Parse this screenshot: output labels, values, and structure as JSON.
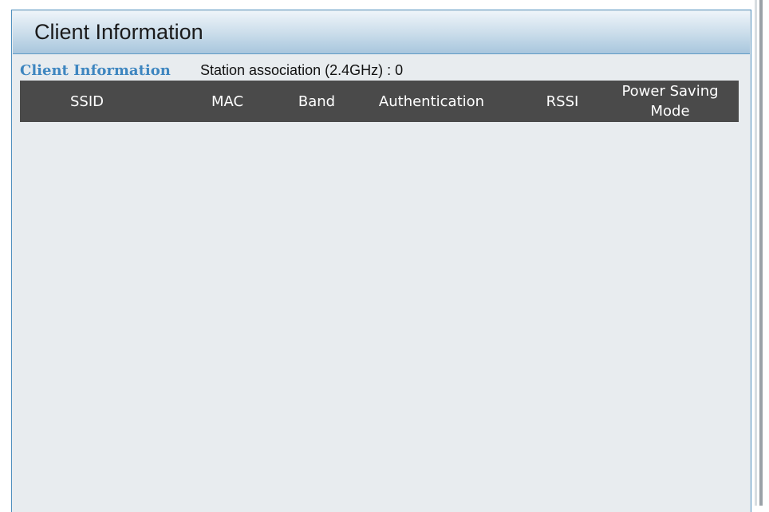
{
  "panel": {
    "title": "Client Information"
  },
  "section": {
    "label": "Client Information",
    "station_text": "Station association (2.4GHz) :  0"
  },
  "table": {
    "columns": [
      "SSID",
      "MAC",
      "Band",
      "Authentication",
      "RSSI",
      "Power Saving Mode"
    ],
    "rows": []
  },
  "colors": {
    "header_bar": "#4a4a4a",
    "section_label": "#3e86c0",
    "panel_bg": "#e8ecef",
    "panel_border": "#4f8fbe"
  }
}
